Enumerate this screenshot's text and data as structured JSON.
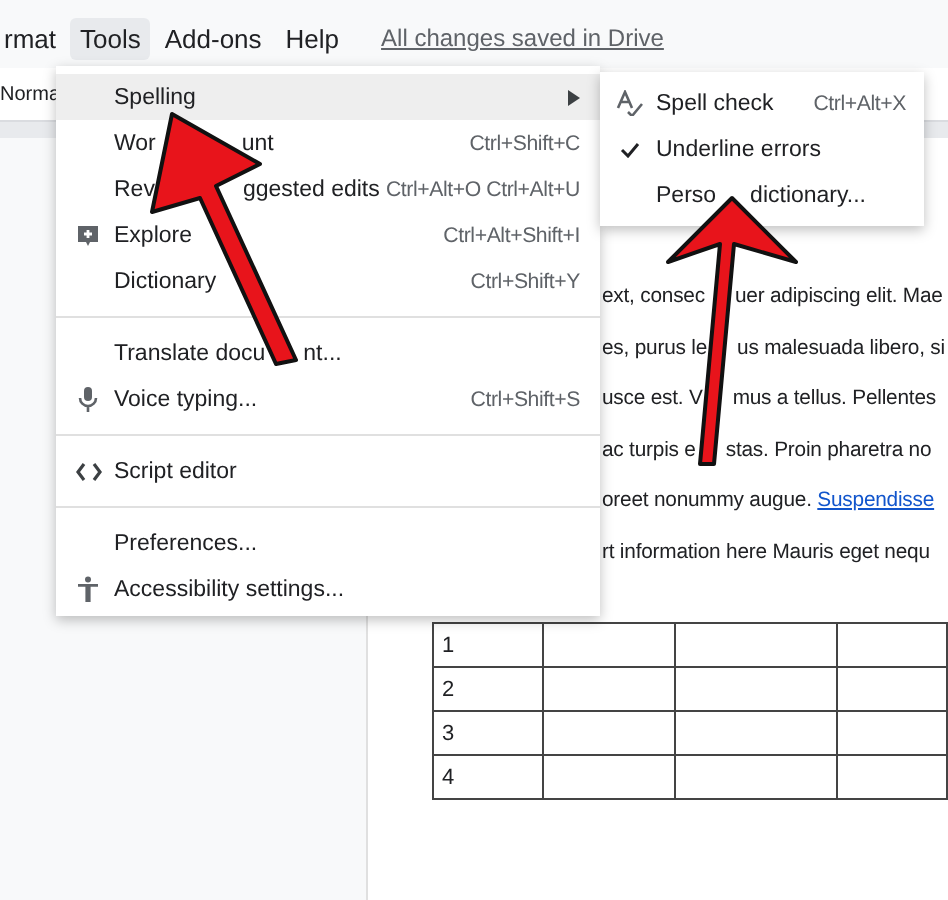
{
  "menubar": [
    {
      "label": "rmat",
      "selected": false
    },
    {
      "label": "Tools",
      "selected": true
    },
    {
      "label": "Add-ons",
      "selected": false
    },
    {
      "label": "Help",
      "selected": false
    }
  ],
  "save_status": "All changes saved in Drive",
  "toolbar": {
    "style": "Norma"
  },
  "document": {
    "lines": [
      {
        "parts": [
          "ext, consec",
          "uer adipiscing elit. Mae"
        ]
      },
      {
        "parts": [
          "es, purus le",
          "us malesuada libero, si"
        ]
      },
      {
        "parts": [
          "usce est. V",
          "mus a tellus. Pellentes"
        ]
      },
      {
        "parts": [
          "ac turpis e",
          "stas. Proin pharetra no"
        ]
      },
      {
        "text": "oreet nonummy augue. ",
        "link": "Suspendisse"
      },
      {
        "text": "rt information here Mauris eget nequ"
      }
    ],
    "table": {
      "row_labels": [
        "1",
        "2",
        "3",
        "4"
      ]
    }
  },
  "tools_menu": {
    "sections": [
      [
        {
          "label": "Spelling",
          "kind": "submenu",
          "selected": true
        },
        {
          "parts": [
            "Wor",
            "unt"
          ],
          "shortcut": "Ctrl+Shift+C",
          "kind": "item",
          "selected": false
        },
        {
          "parts": [
            "Rev",
            "ggested edits"
          ],
          "shortcut": "Ctrl+Alt+O Ctrl+Alt+U",
          "kind": "item",
          "selected": false
        },
        {
          "label": "Explore",
          "shortcut": "Ctrl+Alt+Shift+I",
          "kind": "item",
          "selected": false
        },
        {
          "label": "Dictionary",
          "shortcut": "Ctrl+Shift+Y",
          "kind": "item",
          "selected": false
        }
      ],
      [
        {
          "parts": [
            "Translate docu",
            "nt..."
          ],
          "kind": "item",
          "selected": false
        },
        {
          "label": "Voice typing...",
          "shortcut": "Ctrl+Shift+S",
          "kind": "item",
          "selected": false
        }
      ],
      [
        {
          "label": "Script editor",
          "kind": "item",
          "selected": false
        }
      ],
      [
        {
          "label": "Preferences...",
          "kind": "item",
          "selected": false
        },
        {
          "label": "Accessibility settings...",
          "kind": "item",
          "selected": false
        }
      ]
    ]
  },
  "spelling_menu": {
    "items": [
      {
        "label": "Spell check",
        "shortcut": "Ctrl+Alt+X",
        "checked": false
      },
      {
        "label": "Underline errors",
        "checked": true
      },
      {
        "parts": [
          "Perso",
          "dictionary..."
        ],
        "checked": false
      }
    ]
  }
}
